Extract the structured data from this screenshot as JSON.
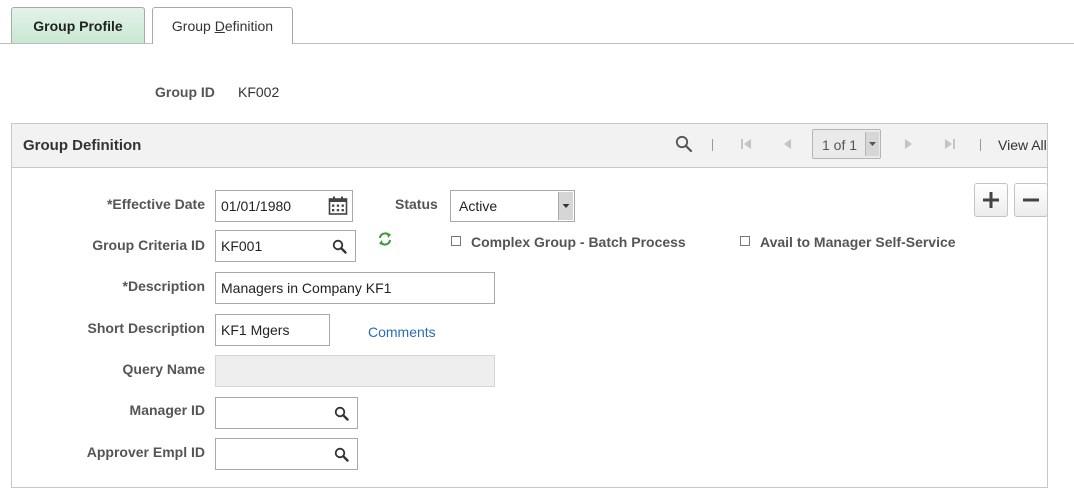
{
  "tabs": [
    {
      "label": "Group Profile",
      "active": true
    },
    {
      "label_prefix": "Group ",
      "label_underline": "D",
      "label_suffix": "efinition",
      "active": false
    }
  ],
  "header": {
    "group_id_label": "Group ID",
    "group_id_value": "KF002"
  },
  "panel": {
    "title": "Group Definition",
    "pager_text": "1 of 1",
    "view_all": "View All"
  },
  "form": {
    "effective_date_label": "*Effective Date",
    "effective_date_value": "01/01/1980",
    "status_label": "Status",
    "status_value": "Active",
    "group_criteria_label": "Group Criteria ID",
    "group_criteria_value": "KF001",
    "complex_group_label": "Complex Group - Batch Process",
    "avail_manager_label": "Avail to Manager Self-Service",
    "description_label": "*Description",
    "description_value": "Managers in Company KF1",
    "short_description_label": "Short Description",
    "short_description_value": "KF1 Mgers",
    "comments_link": "Comments",
    "query_name_label": "Query Name",
    "query_name_value": "",
    "manager_id_label": "Manager ID",
    "manager_id_value": "",
    "approver_label": "Approver Empl ID",
    "approver_value": ""
  },
  "colors": {
    "active_tab": "#c9e8d2",
    "link": "#2a6cb5",
    "refresh_icon": "#3a9a3a"
  },
  "icons": [
    "search-icon",
    "first-page-icon",
    "prev-page-icon",
    "next-page-icon",
    "last-page-icon",
    "calendar-icon",
    "lookup-icon",
    "refresh-icon",
    "add-row-icon",
    "delete-row-icon"
  ]
}
